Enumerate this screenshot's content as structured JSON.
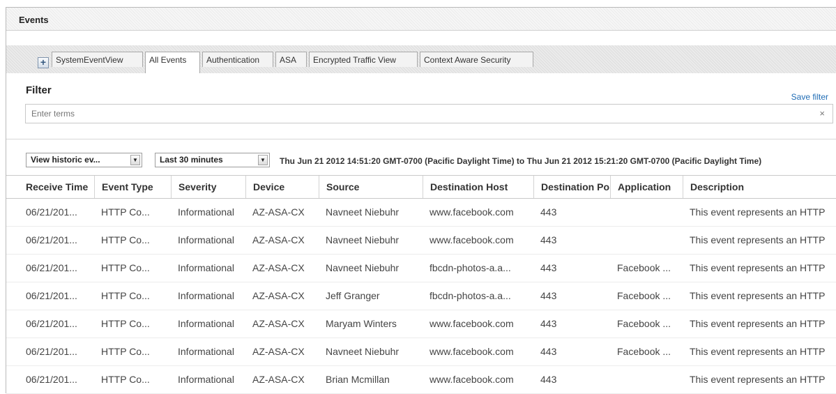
{
  "window": {
    "title": "Events"
  },
  "tabs": [
    {
      "label": "SystemEventView"
    },
    {
      "label": "All Events",
      "active": true
    },
    {
      "label": "Authentication"
    },
    {
      "label": "ASA"
    },
    {
      "label": "Encrypted Traffic View"
    },
    {
      "label": "Context Aware Security"
    }
  ],
  "add_tab": {
    "label": "+"
  },
  "filter": {
    "title": "Filter",
    "save_label": "Save filter",
    "placeholder": "Enter terms",
    "clear_label": "×"
  },
  "toolbar": {
    "view_select": "View historic ev...",
    "time_select": "Last 30 minutes",
    "range_text": "Thu Jun 21 2012 14:51:20 GMT-0700 (Pacific Daylight Time) to Thu Jun 21 2012 15:21:20 GMT-0700 (Pacific Daylight Time)",
    "dropdown_glyph": "▼"
  },
  "table": {
    "columns": [
      "Receive Time",
      "Event Type",
      "Severity",
      "Device",
      "Source",
      "Destination Host",
      "Destination Po",
      "Application",
      "Description"
    ],
    "rows": [
      [
        "06/21/201...",
        "HTTP Co...",
        "Informational",
        "AZ-ASA-CX",
        "Navneet Niebuhr",
        "www.facebook.com",
        "443",
        "",
        "This event represents an HTTP"
      ],
      [
        "06/21/201...",
        "HTTP Co...",
        "Informational",
        "AZ-ASA-CX",
        "Navneet Niebuhr",
        "www.facebook.com",
        "443",
        "",
        "This event represents an HTTP"
      ],
      [
        "06/21/201...",
        "HTTP Co...",
        "Informational",
        "AZ-ASA-CX",
        "Navneet Niebuhr",
        "fbcdn-photos-a.a...",
        "443",
        "Facebook ...",
        "This event represents an HTTP"
      ],
      [
        "06/21/201...",
        "HTTP Co...",
        "Informational",
        "AZ-ASA-CX",
        "Jeff Granger",
        "fbcdn-photos-a.a...",
        "443",
        "Facebook ...",
        "This event represents an HTTP"
      ],
      [
        "06/21/201...",
        "HTTP Co...",
        "Informational",
        "AZ-ASA-CX",
        "Maryam Winters",
        "www.facebook.com",
        "443",
        "Facebook ...",
        "This event represents an HTTP"
      ],
      [
        "06/21/201...",
        "HTTP Co...",
        "Informational",
        "AZ-ASA-CX",
        "Navneet Niebuhr",
        "www.facebook.com",
        "443",
        "Facebook ...",
        "This event represents an HTTP"
      ],
      [
        "06/21/201...",
        "HTTP Co...",
        "Informational",
        "AZ-ASA-CX",
        "Brian Mcmillan",
        "www.facebook.com",
        "443",
        "",
        "This event represents an HTTP"
      ]
    ]
  },
  "colors": {
    "link": "#1f6cb5",
    "border": "#b9b9b9"
  }
}
